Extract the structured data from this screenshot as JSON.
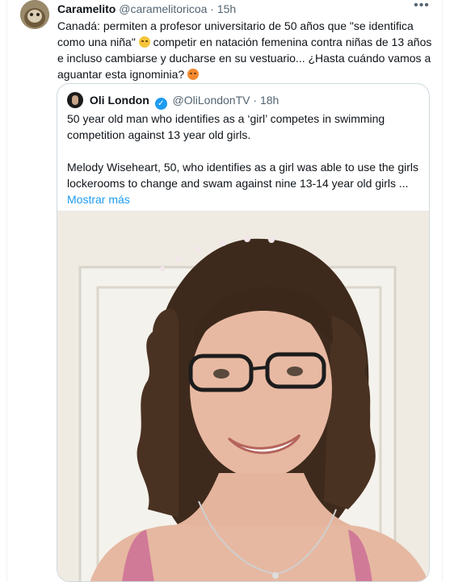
{
  "tweet": {
    "display_name": "Caramelito",
    "handle": "@caramelitoricoa",
    "separator": "·",
    "time": "15h",
    "more_icon": "more-horizontal-icon",
    "text_1": "Canadá: permiten a profesor universitario de 50 años que \"se identifica como una niña\" ",
    "text_2": " competir en natación femenina contra niñas de 13 años e incluso cambiarse y ducharse en su vestuario... ¿Hasta cuándo vamos a aguantar esta ignominia? ",
    "emoji_1": "unamused-face-emoji",
    "emoji_2": "angry-face-emoji"
  },
  "quote": {
    "display_name": "Oli London",
    "verified_icon": "verified-badge-icon",
    "handle": "@OliLondonTV",
    "separator": "·",
    "time": "18h",
    "paragraph_1": "50 year old man who identifies as a ‘girl’ competes in swimming competition against 13 year old girls.",
    "paragraph_2": "Melody Wiseheart, 50, who identifies as a girl was able to use the girls lockerooms to change and swam against nine 13-14 year old girls ...",
    "show_more": "Mostrar más"
  },
  "colors": {
    "text": "#0f1419",
    "secondary": "#536471",
    "link": "#1d9bf0",
    "border": "#cfd9de"
  }
}
